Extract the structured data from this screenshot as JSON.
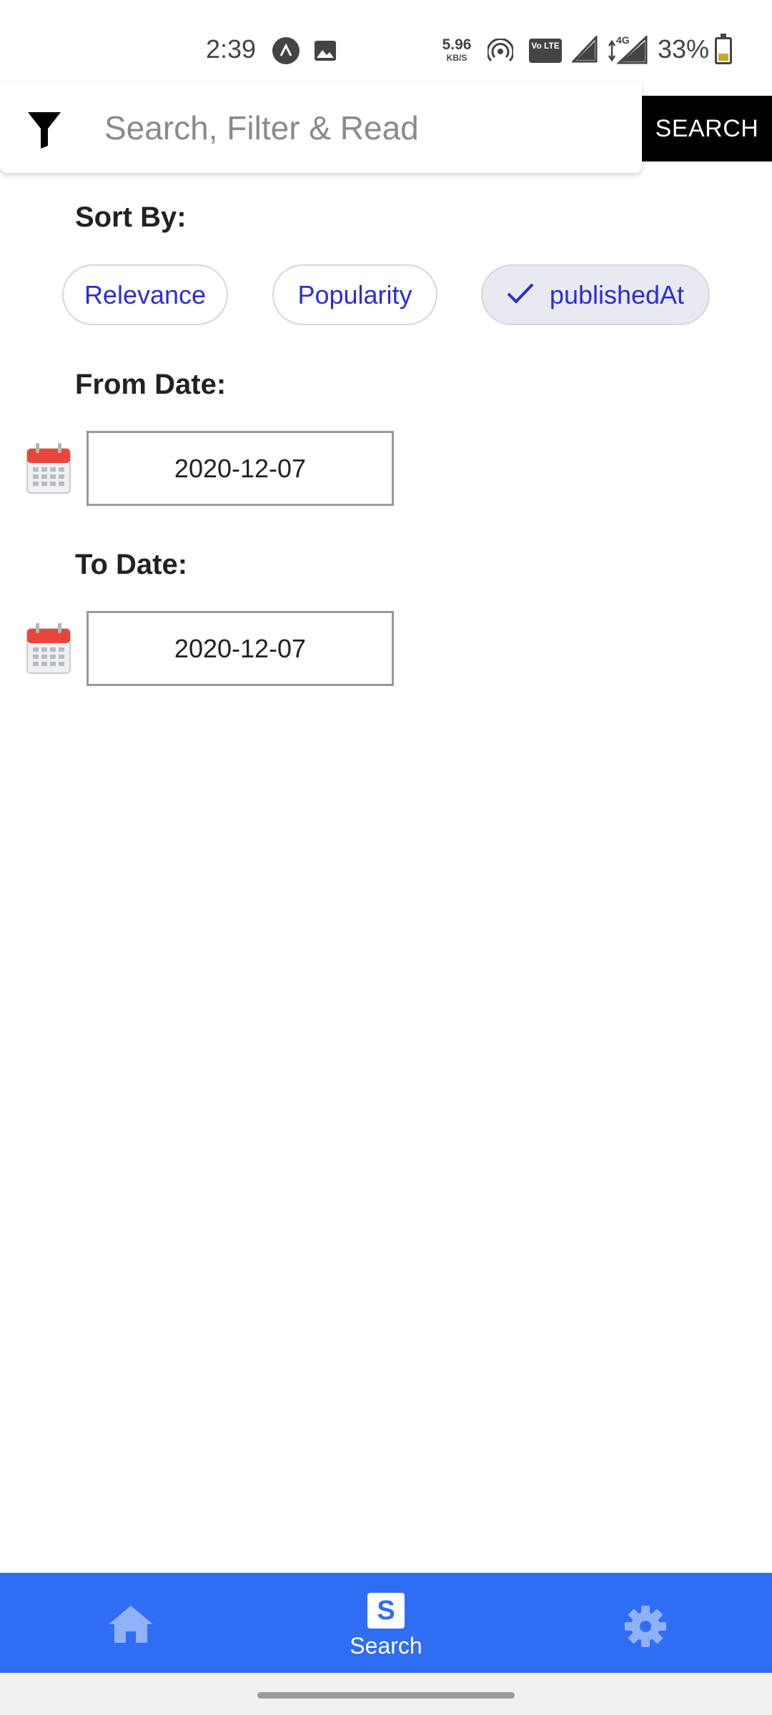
{
  "status_bar": {
    "time": "2:39",
    "net_speed_value": "5.96",
    "net_speed_unit": "KB/S",
    "volte_label": "Vo LTE",
    "network_type": "4G",
    "battery_percent": "33%",
    "icons": [
      "app-notification-icon",
      "image-notification-icon",
      "hotspot-icon",
      "volte-icon",
      "signal-icon",
      "battery-charging-icon"
    ]
  },
  "search": {
    "placeholder": "Search, Filter & Read",
    "value": "",
    "button_label": "SEARCH",
    "filter_icon": "filter-icon"
  },
  "sort": {
    "label": "Sort By:",
    "options": [
      {
        "label": "Relevance",
        "selected": false
      },
      {
        "label": "Popularity",
        "selected": false
      },
      {
        "label": "publishedAt",
        "selected": true
      }
    ]
  },
  "from_date": {
    "label": "From Date:",
    "value": "2020-12-07",
    "icon": "calendar-icon"
  },
  "to_date": {
    "label": "To Date:",
    "value": "2020-12-07",
    "icon": "calendar-icon"
  },
  "bottom_nav": {
    "items": [
      {
        "name": "home",
        "icon": "home-icon",
        "label": ""
      },
      {
        "name": "search",
        "icon": "search-s-icon",
        "label": "Search",
        "badge": "S",
        "active": true
      },
      {
        "name": "settings",
        "icon": "gear-icon",
        "label": ""
      }
    ]
  },
  "colors": {
    "accent": "#2f6df5",
    "chip_text": "#2a2fd0",
    "chip_selected_bg": "#e9e9f1",
    "search_button_bg": "#000000",
    "calendar_red": "#e8463a"
  }
}
